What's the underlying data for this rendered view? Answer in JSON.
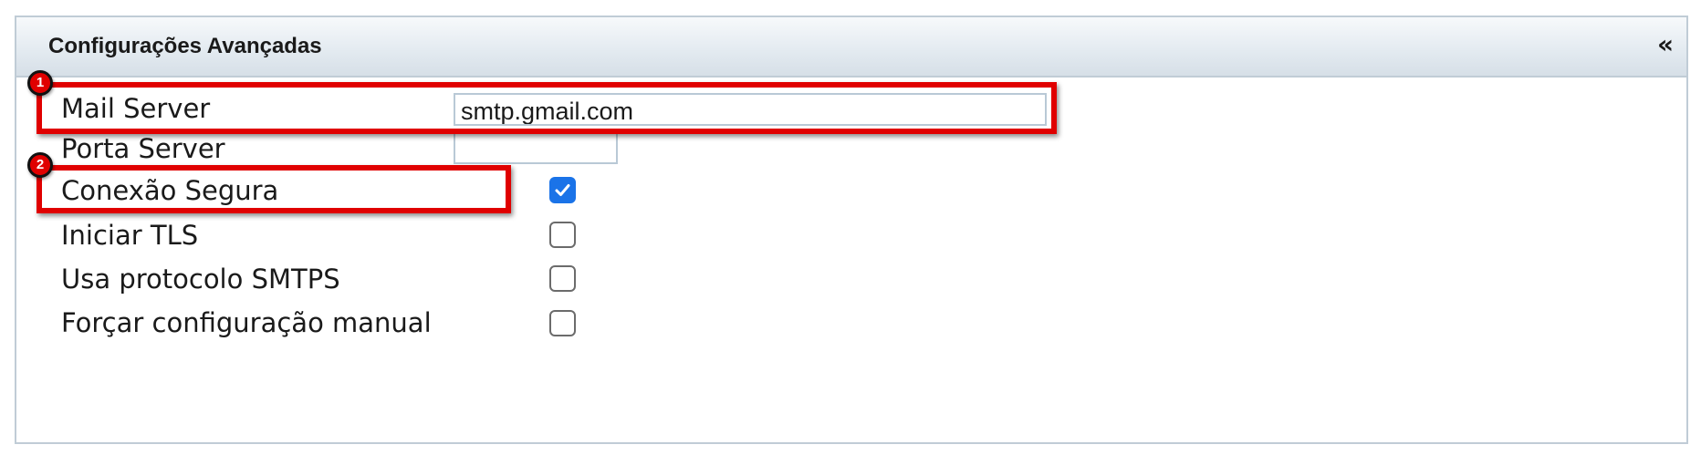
{
  "panel": {
    "title": "Configurações Avançadas",
    "collapse_symbol": "«"
  },
  "fields": {
    "mail_server": {
      "label": "Mail Server",
      "value": "smtp.gmail.com"
    },
    "porta_server": {
      "label": "Porta Server",
      "value": ""
    },
    "conexao_segura": {
      "label": "Conexão Segura",
      "checked": true
    },
    "iniciar_tls": {
      "label": "Iniciar TLS",
      "checked": false
    },
    "smtps": {
      "label": "Usa protocolo SMTPS",
      "checked": false
    },
    "forcar_manual": {
      "label": "Forçar configuração manual",
      "checked": false
    }
  },
  "annotations": {
    "marker_1": "1",
    "marker_2": "2"
  },
  "colors": {
    "highlight": "#e00000",
    "checkbox_checked": "#1a73e8"
  },
  "icons": {
    "collapse": "double-chevron-left-icon",
    "check": "checkmark-icon"
  }
}
